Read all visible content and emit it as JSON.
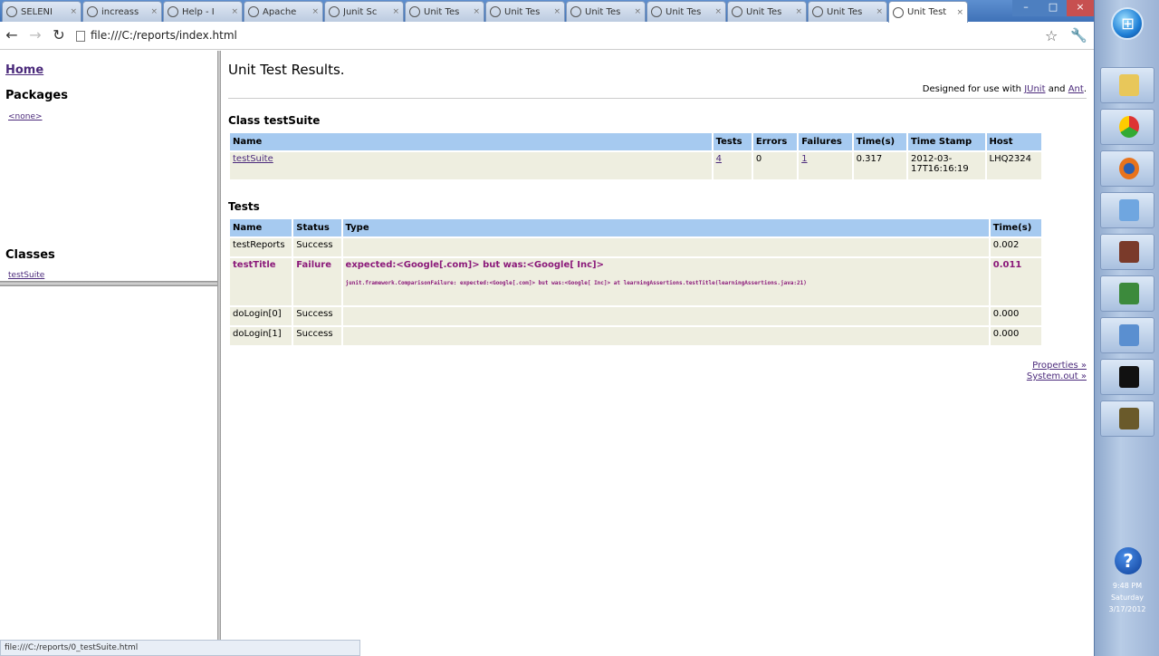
{
  "tabs": [
    {
      "label": "SELENI"
    },
    {
      "label": "increass"
    },
    {
      "label": "Help - I"
    },
    {
      "label": "Apache"
    },
    {
      "label": "Junit Sc"
    },
    {
      "label": "Unit Tes"
    },
    {
      "label": "Unit Tes"
    },
    {
      "label": "Unit Tes"
    },
    {
      "label": "Unit Tes"
    },
    {
      "label": "Unit Tes"
    },
    {
      "label": "Unit Tes"
    },
    {
      "label": "Unit Test"
    }
  ],
  "toolbar": {
    "url": "file:///C:/reports/index.html"
  },
  "left": {
    "home": "Home",
    "packages_heading": "Packages",
    "package_none": "<none>",
    "classes_heading": "Classes",
    "class_link": "testSuite"
  },
  "main": {
    "title": "Unit Test Results.",
    "designed_prefix": "Designed for use with",
    "designed_junit": "JUnit",
    "designed_and": "and",
    "designed_ant": "Ant",
    "class_heading": "Class testSuite",
    "class_table": {
      "headers": [
        "Name",
        "Tests",
        "Errors",
        "Failures",
        "Time(s)",
        "Time Stamp",
        "Host"
      ],
      "row": {
        "name": "testSuite",
        "tests": "4",
        "errors": "0",
        "failures": "1",
        "time": "0.317",
        "timestamp": "2012-03-17T16:16:19",
        "host": "LHQ2324"
      }
    },
    "tests_heading": "Tests",
    "tests_table": {
      "headers": [
        "Name",
        "Status",
        "Type",
        "Time(s)"
      ],
      "rows": [
        {
          "name": "testReports",
          "status": "Success",
          "type": "",
          "trace": "",
          "time": "0.002"
        },
        {
          "name": "testTitle",
          "status": "Failure",
          "type": "expected:<Google[.com]> but was:<Google[ Inc]>",
          "trace": "junit.framework.ComparisonFailure: expected:<Google[.com]> but was:<Google[ Inc]> at learningAssertions.testTitle(learningAssertions.java:21)",
          "time": "0.011"
        },
        {
          "name": "doLogin[0]",
          "status": "Success",
          "type": "",
          "trace": "",
          "time": "0.000"
        },
        {
          "name": "doLogin[1]",
          "status": "Success",
          "type": "",
          "trace": "",
          "time": "0.000"
        }
      ]
    },
    "properties_link": "Properties »",
    "systemout_link": "System.out »"
  },
  "status_bar": "file:///C:/reports/0_testSuite.html",
  "taskbar": {
    "help": "?",
    "clock": "9:48 PM",
    "day": "Saturday",
    "date": "3/17/2012"
  }
}
